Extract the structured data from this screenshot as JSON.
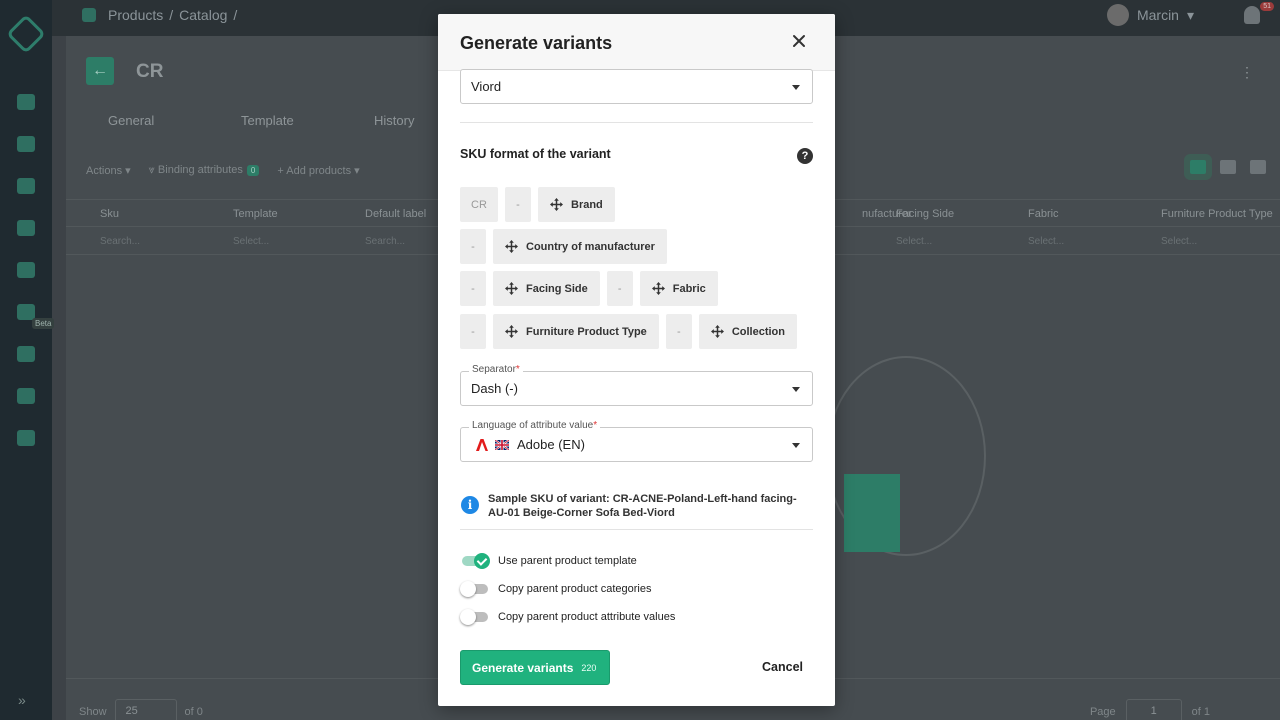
{
  "topbar": {
    "crumbs": [
      "Products",
      "/",
      "Catalog",
      "/"
    ],
    "user_name": "Marcin",
    "notification_count": "51"
  },
  "sidebar": {
    "beta_label": "Beta"
  },
  "page": {
    "title": "CR",
    "tabs": [
      "General",
      "Template",
      "History"
    ],
    "toolbar": {
      "actions": "Actions",
      "binding": "Binding attributes",
      "binding_count": "0",
      "add_products": "Add products"
    },
    "columns": [
      "Sku",
      "Template",
      "Default label",
      "nufacturer",
      "Facing Side",
      "Fabric",
      "Furniture Product Type"
    ],
    "filters": [
      "Search...",
      "Select...",
      "Search...",
      "Select...",
      "Select...",
      "Select..."
    ],
    "footer": {
      "show_label": "Show",
      "show_value": "25",
      "of_total": "of 0",
      "page_label": "Page",
      "page_value": "1",
      "of_pages": "of 1"
    }
  },
  "modal": {
    "title": "Generate variants",
    "top_select_value": "Viord",
    "sku_section_title": "SKU format of the variant",
    "sku_rows": [
      [
        {
          "type": "code",
          "label": "CR"
        },
        {
          "type": "sep",
          "label": "-"
        },
        {
          "type": "attr",
          "label": "Brand"
        }
      ],
      [
        {
          "type": "sep",
          "label": "-"
        },
        {
          "type": "attr",
          "label": "Country of manufacturer"
        }
      ],
      [
        {
          "type": "sep",
          "label": "-"
        },
        {
          "type": "attr",
          "label": "Facing Side"
        },
        {
          "type": "sep",
          "label": "-"
        },
        {
          "type": "attr",
          "label": "Fabric"
        }
      ],
      [
        {
          "type": "sep",
          "label": "-"
        },
        {
          "type": "attr",
          "label": "Furniture Product Type"
        },
        {
          "type": "sep",
          "label": "-"
        },
        {
          "type": "attr",
          "label": "Collection"
        }
      ]
    ],
    "separator": {
      "label": "Separator",
      "required_mark": "*",
      "value": "Dash (-)"
    },
    "language": {
      "label": "Language of attribute value",
      "required_mark": "*",
      "value": "Adobe (EN)"
    },
    "sample_sku": "Sample SKU of variant: CR-ACNE-Poland-Left-hand facing-AU-01 Beige-Corner Sofa Bed-Viord",
    "toggles": [
      {
        "label": "Use parent product template",
        "on": true
      },
      {
        "label": "Copy parent product categories",
        "on": false
      },
      {
        "label": "Copy parent product attribute values",
        "on": false
      }
    ],
    "generate_label": "Generate variants",
    "generate_count": "220",
    "cancel_label": "Cancel"
  },
  "colors": {
    "accent": "#20b27e",
    "info": "#1e88e5"
  },
  "icons": [
    "close-icon",
    "help-icon",
    "move-icon",
    "caret-down-icon",
    "info-icon",
    "flag-uk-icon",
    "adobe-icon"
  ]
}
